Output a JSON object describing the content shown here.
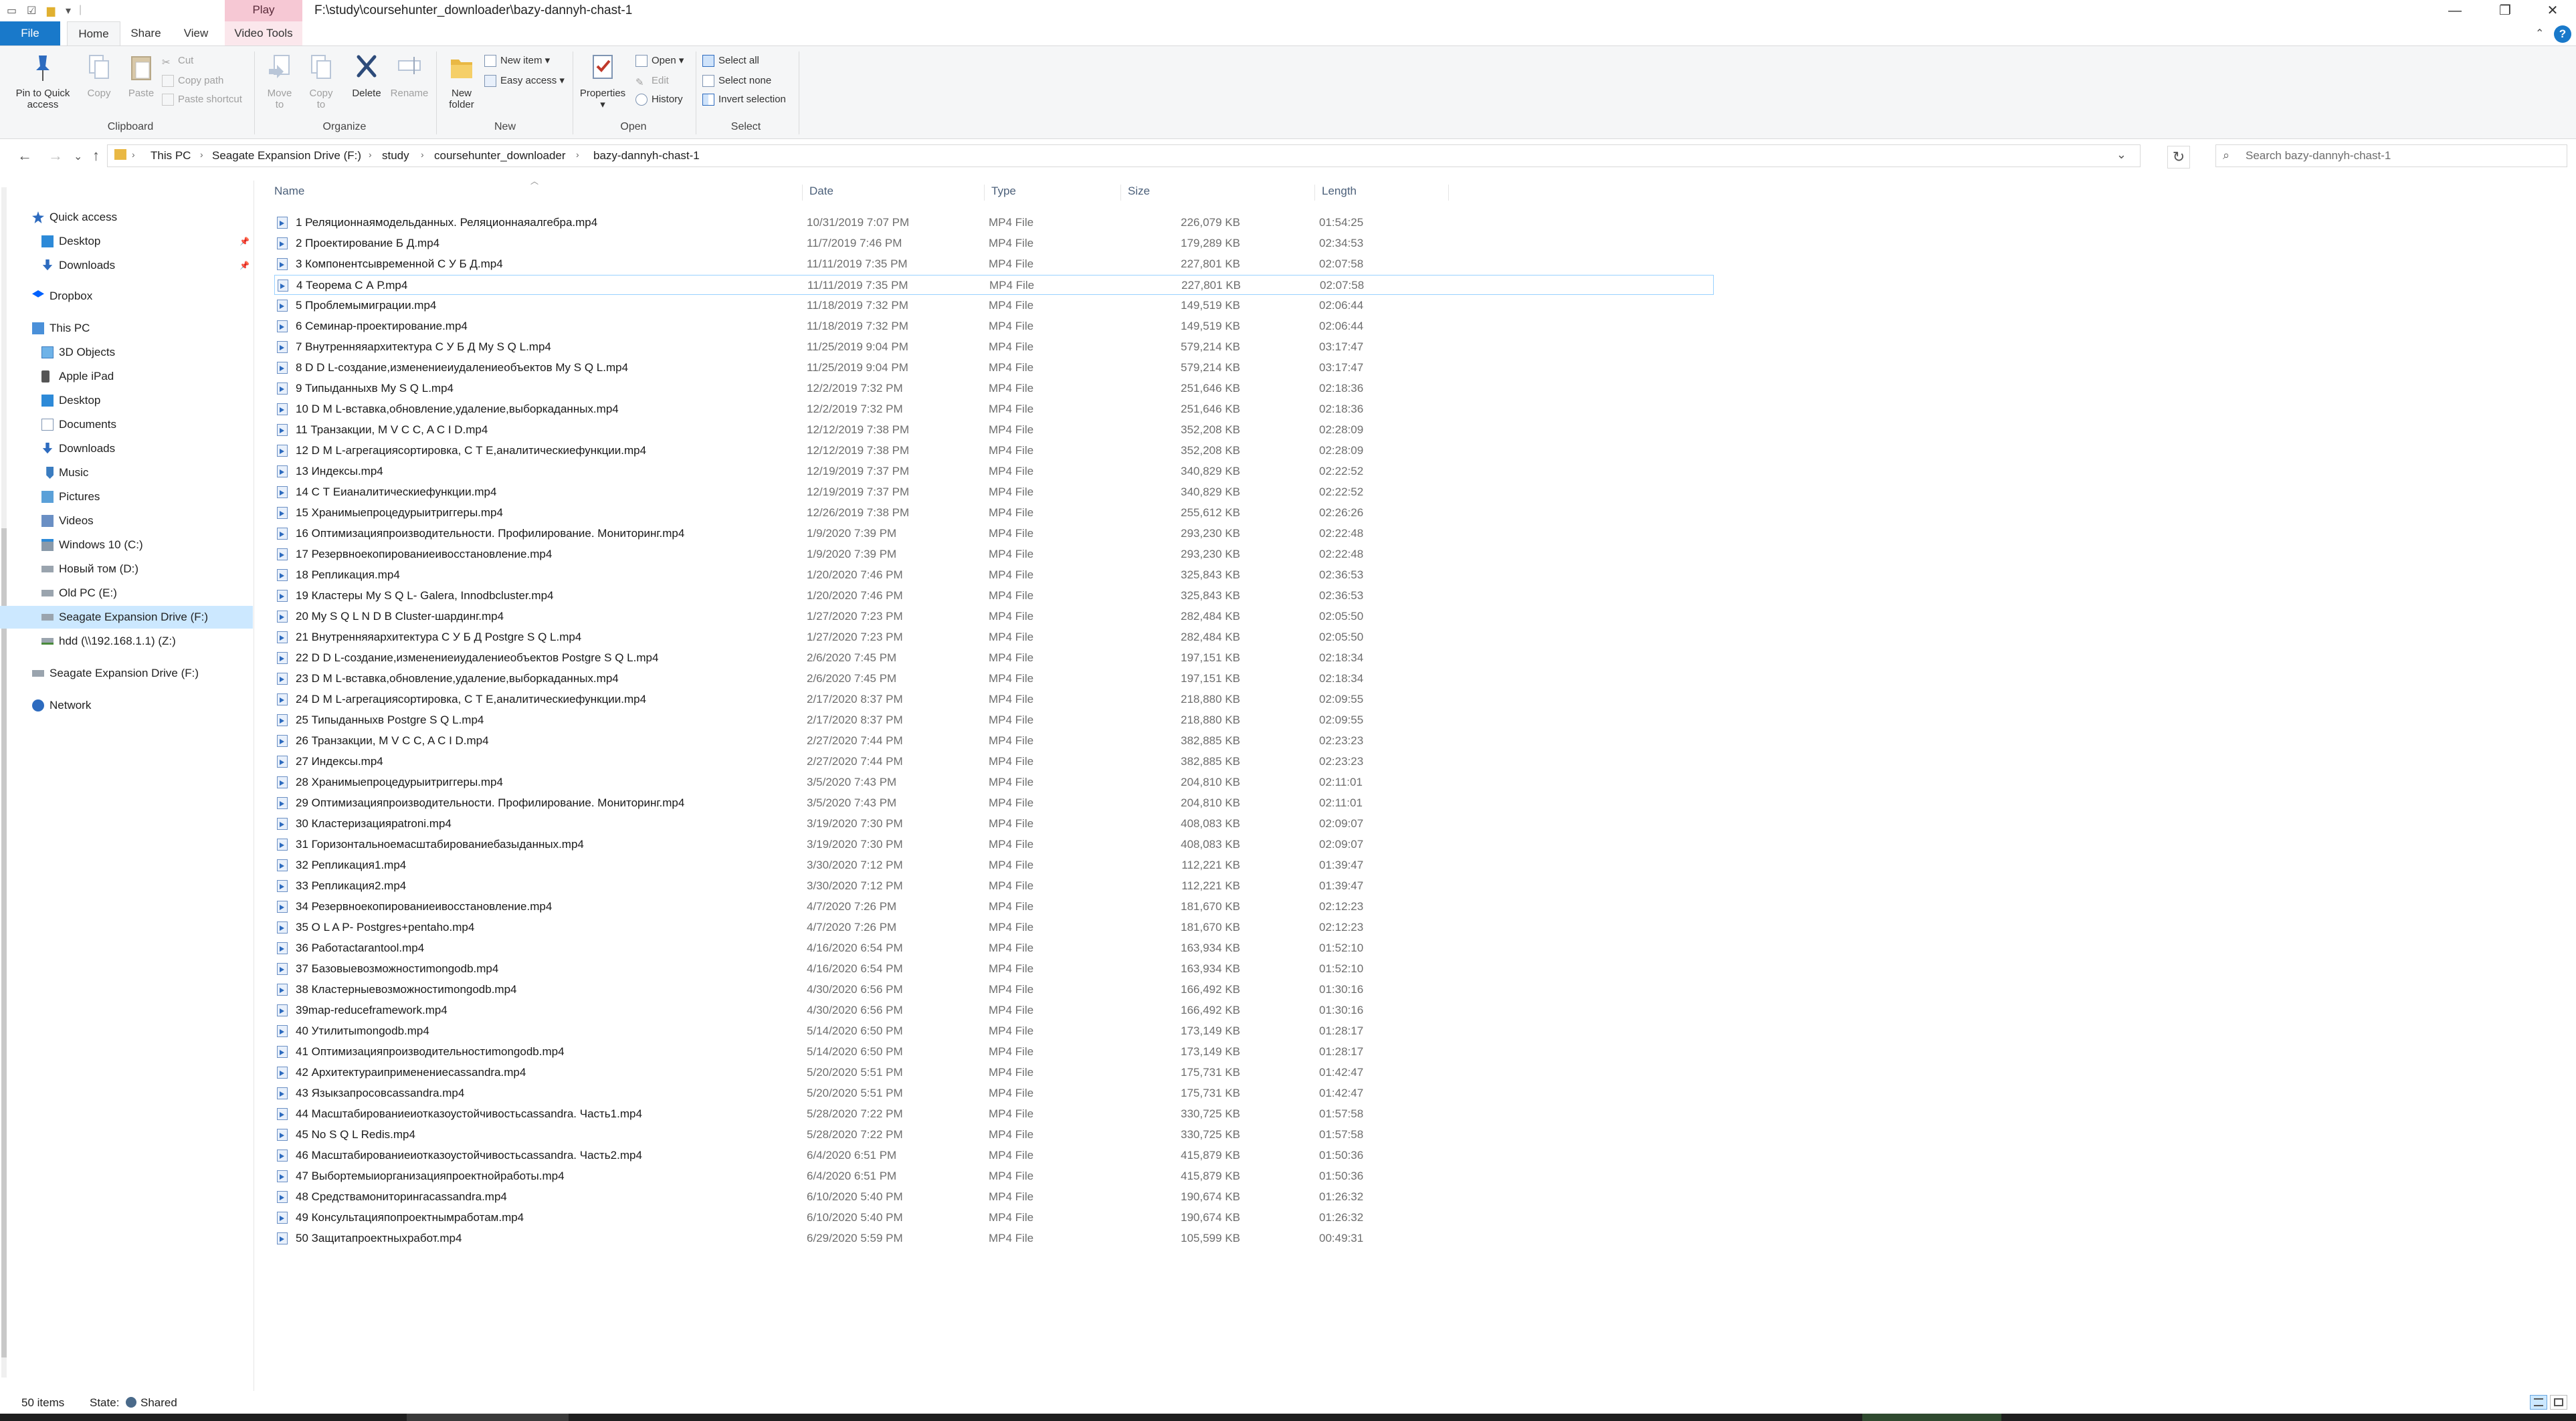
{
  "window": {
    "title": "F:\\study\\coursehunter_downloader\\bazy-dannyh-chast-1",
    "contextual_tab": "Play"
  },
  "ribbon_tabs": [
    "File",
    "Home",
    "Share",
    "View",
    "Video Tools"
  ],
  "ribbon": {
    "clipboard": {
      "label": "Clipboard",
      "pin": "Pin to Quick access",
      "copy": "Copy",
      "paste": "Paste",
      "cut": "Cut",
      "copy_path": "Copy path",
      "paste_shortcut": "Paste shortcut"
    },
    "organize": {
      "label": "Organize",
      "move_to": "Move to",
      "copy_to": "Copy to",
      "delete": "Delete",
      "rename": "Rename"
    },
    "new": {
      "label": "New",
      "new_folder": "New folder",
      "new_item": "New item",
      "easy_access": "Easy access"
    },
    "open": {
      "label": "Open",
      "properties": "Properties",
      "open": "Open",
      "edit": "Edit",
      "history": "History"
    },
    "select": {
      "label": "Select",
      "select_all": "Select all",
      "select_none": "Select none",
      "invert_selection": "Invert selection"
    }
  },
  "address": {
    "crumbs": [
      "This PC",
      "Seagate Expansion Drive (F:)",
      "study",
      "coursehunter_downloader",
      "bazy-dannyh-chast-1"
    ],
    "search_placeholder": "Search bazy-dannyh-chast-1"
  },
  "nav_pane": {
    "items": [
      {
        "label": "Quick access",
        "icon": "star-icon",
        "level": 0
      },
      {
        "label": "Desktop",
        "icon": "desktop-folder-icon",
        "level": 1,
        "pinned": true
      },
      {
        "label": "Downloads",
        "icon": "downloads-folder-icon",
        "level": 1,
        "pinned": true
      },
      {
        "label": "Dropbox",
        "icon": "dropbox-icon",
        "level": 0
      },
      {
        "label": "This PC",
        "icon": "computer-icon",
        "level": 0
      },
      {
        "label": "3D Objects",
        "icon": "cube-folder-icon",
        "level": 1
      },
      {
        "label": "Apple iPad",
        "icon": "tablet-icon",
        "level": 1
      },
      {
        "label": "Desktop",
        "icon": "desktop-folder-icon",
        "level": 1
      },
      {
        "label": "Documents",
        "icon": "documents-folder-icon",
        "level": 1
      },
      {
        "label": "Downloads",
        "icon": "downloads-folder-icon",
        "level": 1
      },
      {
        "label": "Music",
        "icon": "music-folder-icon",
        "level": 1
      },
      {
        "label": "Pictures",
        "icon": "pictures-folder-icon",
        "level": 1
      },
      {
        "label": "Videos",
        "icon": "videos-folder-icon",
        "level": 1
      },
      {
        "label": "Windows 10 (C:)",
        "icon": "windows-drive-icon",
        "level": 1
      },
      {
        "label": "Новый том (D:)",
        "icon": "drive-icon",
        "level": 1
      },
      {
        "label": "Old PC (E:)",
        "icon": "drive-icon",
        "level": 1
      },
      {
        "label": "Seagate Expansion Drive (F:)",
        "icon": "drive-icon",
        "level": 1,
        "selected": true
      },
      {
        "label": "hdd (\\\\192.168.1.1) (Z:)",
        "icon": "network-drive-icon",
        "level": 1
      },
      {
        "label": "Seagate Expansion Drive (F:)",
        "icon": "drive-icon",
        "level": 0
      },
      {
        "label": "Network",
        "icon": "network-icon",
        "level": 0
      }
    ]
  },
  "columns": {
    "name": "Name",
    "date": "Date",
    "type": "Type",
    "size": "Size",
    "length": "Length"
  },
  "files": [
    {
      "name": "1 Реляционнаямодельданных. Реляционнаяалгебра.mp4",
      "date": "10/31/2019 7:07 PM",
      "type": "MP4 File",
      "size": "226,079 KB",
      "length": "01:54:25"
    },
    {
      "name": "2 Проектирование Б Д.mp4",
      "date": "11/7/2019 7:46 PM",
      "type": "MP4 File",
      "size": "179,289 KB",
      "length": "02:34:53"
    },
    {
      "name": "3 Компонентсывременной С У Б Д.mp4",
      "date": "11/11/2019 7:35 PM",
      "type": "MP4 File",
      "size": "227,801 KB",
      "length": "02:07:58"
    },
    {
      "name": "4 Теорема С А Р.mp4",
      "date": "11/11/2019 7:35 PM",
      "type": "MP4 File",
      "size": "227,801 KB",
      "length": "02:07:58"
    },
    {
      "name": "5 Проблемымиграции.mp4",
      "date": "11/18/2019 7:32 PM",
      "type": "MP4 File",
      "size": "149,519 KB",
      "length": "02:06:44"
    },
    {
      "name": "6 Семинар-проектирование.mp4",
      "date": "11/18/2019 7:32 PM",
      "type": "MP4 File",
      "size": "149,519 KB",
      "length": "02:06:44"
    },
    {
      "name": "7 Внутренняяархитектура С У Б Д My S Q L.mp4",
      "date": "11/25/2019 9:04 PM",
      "type": "MP4 File",
      "size": "579,214 KB",
      "length": "03:17:47"
    },
    {
      "name": "8 D D L-создание,изменениеиудалениеобъектов My S Q L.mp4",
      "date": "11/25/2019 9:04 PM",
      "type": "MP4 File",
      "size": "579,214 KB",
      "length": "03:17:47"
    },
    {
      "name": "9 Типыданныхв My S Q L.mp4",
      "date": "12/2/2019 7:32 PM",
      "type": "MP4 File",
      "size": "251,646 KB",
      "length": "02:18:36"
    },
    {
      "name": "10 D M L-вставка,обновление,удаление,выборкаданных.mp4",
      "date": "12/2/2019 7:32 PM",
      "type": "MP4 File",
      "size": "251,646 KB",
      "length": "02:18:36"
    },
    {
      "name": "11 Транзакции, M V C C, A C I D.mp4",
      "date": "12/12/2019 7:38 PM",
      "type": "MP4 File",
      "size": "352,208 KB",
      "length": "02:28:09"
    },
    {
      "name": "12 D M L-агрегациясортировка, С Т Е,аналитическиефункции.mp4",
      "date": "12/12/2019 7:38 PM",
      "type": "MP4 File",
      "size": "352,208 KB",
      "length": "02:28:09"
    },
    {
      "name": "13 Индексы.mp4",
      "date": "12/19/2019 7:37 PM",
      "type": "MP4 File",
      "size": "340,829 KB",
      "length": "02:22:52"
    },
    {
      "name": "14 С Т Еианалитическиефункции.mp4",
      "date": "12/19/2019 7:37 PM",
      "type": "MP4 File",
      "size": "340,829 KB",
      "length": "02:22:52"
    },
    {
      "name": "15 Хранимыепроцедурыитриггеры.mp4",
      "date": "12/26/2019 7:38 PM",
      "type": "MP4 File",
      "size": "255,612 KB",
      "length": "02:26:26"
    },
    {
      "name": "16 Оптимизацияпроизводительности. Профилирование. Мониторинг.mp4",
      "date": "1/9/2020 7:39 PM",
      "type": "MP4 File",
      "size": "293,230 KB",
      "length": "02:22:48"
    },
    {
      "name": "17 Резервноекопированиеивосстановление.mp4",
      "date": "1/9/2020 7:39 PM",
      "type": "MP4 File",
      "size": "293,230 KB",
      "length": "02:22:48"
    },
    {
      "name": "18 Репликация.mp4",
      "date": "1/20/2020 7:46 PM",
      "type": "MP4 File",
      "size": "325,843 KB",
      "length": "02:36:53"
    },
    {
      "name": "19 Кластеры My S Q L- Galera, Innodbcluster.mp4",
      "date": "1/20/2020 7:46 PM",
      "type": "MP4 File",
      "size": "325,843 KB",
      "length": "02:36:53"
    },
    {
      "name": "20 My S Q L N D B Cluster-шардинг.mp4",
      "date": "1/27/2020 7:23 PM",
      "type": "MP4 File",
      "size": "282,484 KB",
      "length": "02:05:50"
    },
    {
      "name": "21 Внутренняяархитектура С У Б Д Postgre S Q L.mp4",
      "date": "1/27/2020 7:23 PM",
      "type": "MP4 File",
      "size": "282,484 KB",
      "length": "02:05:50"
    },
    {
      "name": "22 D D L-создание,изменениеиудалениеобъектов Postgre S Q L.mp4",
      "date": "2/6/2020 7:45 PM",
      "type": "MP4 File",
      "size": "197,151 KB",
      "length": "02:18:34"
    },
    {
      "name": "23 D M L-вставка,обновление,удаление,выборкаданных.mp4",
      "date": "2/6/2020 7:45 PM",
      "type": "MP4 File",
      "size": "197,151 KB",
      "length": "02:18:34"
    },
    {
      "name": "24 D M L-агрегациясортировка, С Т Е,аналитическиефункции.mp4",
      "date": "2/17/2020 8:37 PM",
      "type": "MP4 File",
      "size": "218,880 KB",
      "length": "02:09:55"
    },
    {
      "name": "25 Типыданныхв Postgre S Q L.mp4",
      "date": "2/17/2020 8:37 PM",
      "type": "MP4 File",
      "size": "218,880 KB",
      "length": "02:09:55"
    },
    {
      "name": "26 Транзакции, M V C C, A C I D.mp4",
      "date": "2/27/2020 7:44 PM",
      "type": "MP4 File",
      "size": "382,885 KB",
      "length": "02:23:23"
    },
    {
      "name": "27 Индексы.mp4",
      "date": "2/27/2020 7:44 PM",
      "type": "MP4 File",
      "size": "382,885 KB",
      "length": "02:23:23"
    },
    {
      "name": "28 Хранимыепроцедурыитриггеры.mp4",
      "date": "3/5/2020 7:43 PM",
      "type": "MP4 File",
      "size": "204,810 KB",
      "length": "02:11:01"
    },
    {
      "name": "29 Оптимизацияпроизводительности. Профилирование. Мониторинг.mp4",
      "date": "3/5/2020 7:43 PM",
      "type": "MP4 File",
      "size": "204,810 KB",
      "length": "02:11:01"
    },
    {
      "name": "30 Кластеризацияpatroni.mp4",
      "date": "3/19/2020 7:30 PM",
      "type": "MP4 File",
      "size": "408,083 KB",
      "length": "02:09:07"
    },
    {
      "name": "31 Горизонтальноемасштабированиебазыданных.mp4",
      "date": "3/19/2020 7:30 PM",
      "type": "MP4 File",
      "size": "408,083 KB",
      "length": "02:09:07"
    },
    {
      "name": "32 Репликация1.mp4",
      "date": "3/30/2020 7:12 PM",
      "type": "MP4 File",
      "size": "112,221 KB",
      "length": "01:39:47"
    },
    {
      "name": "33 Репликация2.mp4",
      "date": "3/30/2020 7:12 PM",
      "type": "MP4 File",
      "size": "112,221 KB",
      "length": "01:39:47"
    },
    {
      "name": "34 Резервноекопированиеивосстановление.mp4",
      "date": "4/7/2020 7:26 PM",
      "type": "MP4 File",
      "size": "181,670 KB",
      "length": "02:12:23"
    },
    {
      "name": "35 O L A P- Postgres+pentaho.mp4",
      "date": "4/7/2020 7:26 PM",
      "type": "MP4 File",
      "size": "181,670 KB",
      "length": "02:12:23"
    },
    {
      "name": "36 Работасtarantool.mp4",
      "date": "4/16/2020 6:54 PM",
      "type": "MP4 File",
      "size": "163,934 KB",
      "length": "01:52:10"
    },
    {
      "name": "37 Базовыевозможностиmongodb.mp4",
      "date": "4/16/2020 6:54 PM",
      "type": "MP4 File",
      "size": "163,934 KB",
      "length": "01:52:10"
    },
    {
      "name": "38 Кластерныевозможностиmongodb.mp4",
      "date": "4/30/2020 6:56 PM",
      "type": "MP4 File",
      "size": "166,492 KB",
      "length": "01:30:16"
    },
    {
      "name": "39map-reduceframework.mp4",
      "date": "4/30/2020 6:56 PM",
      "type": "MP4 File",
      "size": "166,492 KB",
      "length": "01:30:16"
    },
    {
      "name": "40 Утилитыmongodb.mp4",
      "date": "5/14/2020 6:50 PM",
      "type": "MP4 File",
      "size": "173,149 KB",
      "length": "01:28:17"
    },
    {
      "name": "41 Оптимизацияпроизводительностиmongodb.mp4",
      "date": "5/14/2020 6:50 PM",
      "type": "MP4 File",
      "size": "173,149 KB",
      "length": "01:28:17"
    },
    {
      "name": "42 Архитектураиприменениеcassandra.mp4",
      "date": "5/20/2020 5:51 PM",
      "type": "MP4 File",
      "size": "175,731 KB",
      "length": "01:42:47"
    },
    {
      "name": "43 Языкзапросовcassandra.mp4",
      "date": "5/20/2020 5:51 PM",
      "type": "MP4 File",
      "size": "175,731 KB",
      "length": "01:42:47"
    },
    {
      "name": "44 Масштабированиеиотказоустойчивостьcassandra. Часть1.mp4",
      "date": "5/28/2020 7:22 PM",
      "type": "MP4 File",
      "size": "330,725 KB",
      "length": "01:57:58"
    },
    {
      "name": "45 No S Q L Redis.mp4",
      "date": "5/28/2020 7:22 PM",
      "type": "MP4 File",
      "size": "330,725 KB",
      "length": "01:57:58"
    },
    {
      "name": "46 Масштабированиеиотказоустойчивостьcassandra. Часть2.mp4",
      "date": "6/4/2020 6:51 PM",
      "type": "MP4 File",
      "size": "415,879 KB",
      "length": "01:50:36"
    },
    {
      "name": "47 Выбортемыиорганизацияпроектнойработы.mp4",
      "date": "6/4/2020 6:51 PM",
      "type": "MP4 File",
      "size": "415,879 KB",
      "length": "01:50:36"
    },
    {
      "name": "48 Средствамониторингаcassandra.mp4",
      "date": "6/10/2020 5:40 PM",
      "type": "MP4 File",
      "size": "190,674 KB",
      "length": "01:26:32"
    },
    {
      "name": "49 Консультацияпопроектнымработам.mp4",
      "date": "6/10/2020 5:40 PM",
      "type": "MP4 File",
      "size": "190,674 KB",
      "length": "01:26:32"
    },
    {
      "name": "50 Защитапроектныхработ.mp4",
      "date": "6/29/2020 5:59 PM",
      "type": "MP4 File",
      "size": "105,599 KB",
      "length": "00:49:31"
    }
  ],
  "status": {
    "count": "50 items",
    "state_label": "State:",
    "state_value": "Shared"
  }
}
